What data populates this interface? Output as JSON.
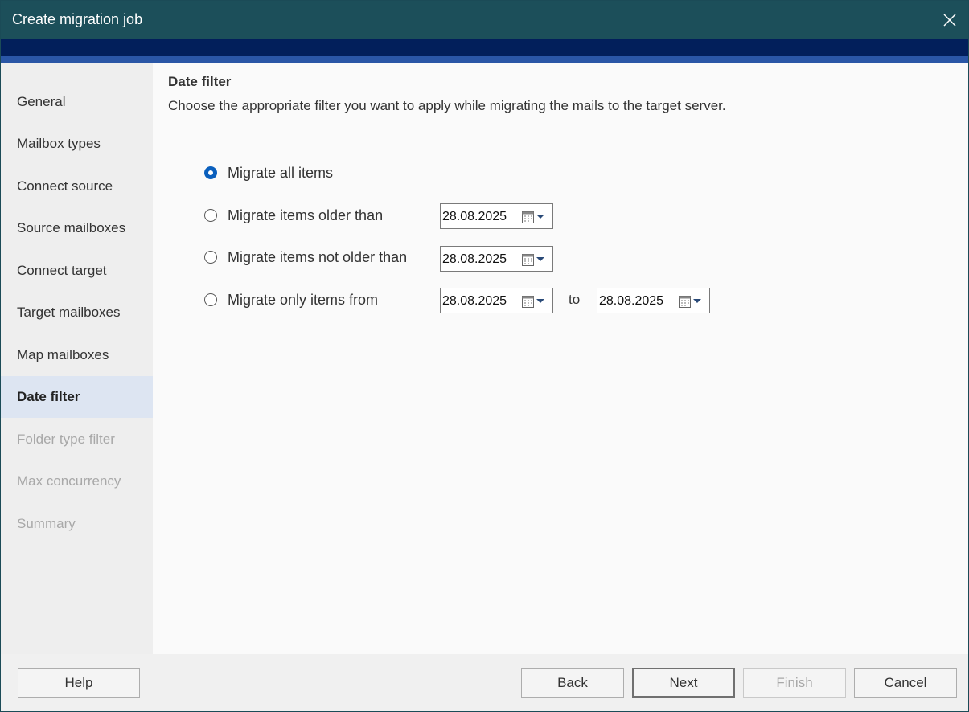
{
  "window": {
    "title": "Create migration job"
  },
  "sidebar": {
    "items": [
      {
        "label": "General",
        "state": "normal"
      },
      {
        "label": "Mailbox types",
        "state": "normal"
      },
      {
        "label": "Connect source",
        "state": "normal"
      },
      {
        "label": "Source mailboxes",
        "state": "normal"
      },
      {
        "label": "Connect target",
        "state": "normal"
      },
      {
        "label": "Target mailboxes",
        "state": "normal"
      },
      {
        "label": "Map mailboxes",
        "state": "normal"
      },
      {
        "label": "Date filter",
        "state": "active"
      },
      {
        "label": "Folder type filter",
        "state": "disabled"
      },
      {
        "label": "Max concurrency",
        "state": "disabled"
      },
      {
        "label": "Summary",
        "state": "disabled"
      }
    ]
  },
  "page": {
    "heading": "Date filter",
    "description": "Choose the appropriate filter you want to apply while migrating the mails to the target server.",
    "options": [
      {
        "label": "Migrate all items",
        "checked": true
      },
      {
        "label": "Migrate items older than",
        "checked": false,
        "date": "28.08.2025"
      },
      {
        "label": "Migrate items not older than",
        "checked": false,
        "date": "28.08.2025"
      },
      {
        "label": "Migrate only items from",
        "checked": false,
        "date": "28.08.2025",
        "to_label": "to",
        "to_date": "28.08.2025"
      }
    ]
  },
  "footer": {
    "help": "Help",
    "back": "Back",
    "next": "Next",
    "finish": "Finish",
    "cancel": "Cancel"
  },
  "colors": {
    "titlebar": "#1c4f5a",
    "band_dark": "#021f5b",
    "band_blue": "#2a56a6",
    "radio_checked": "#0a5fbd",
    "active_nav": "#dde5f2"
  }
}
